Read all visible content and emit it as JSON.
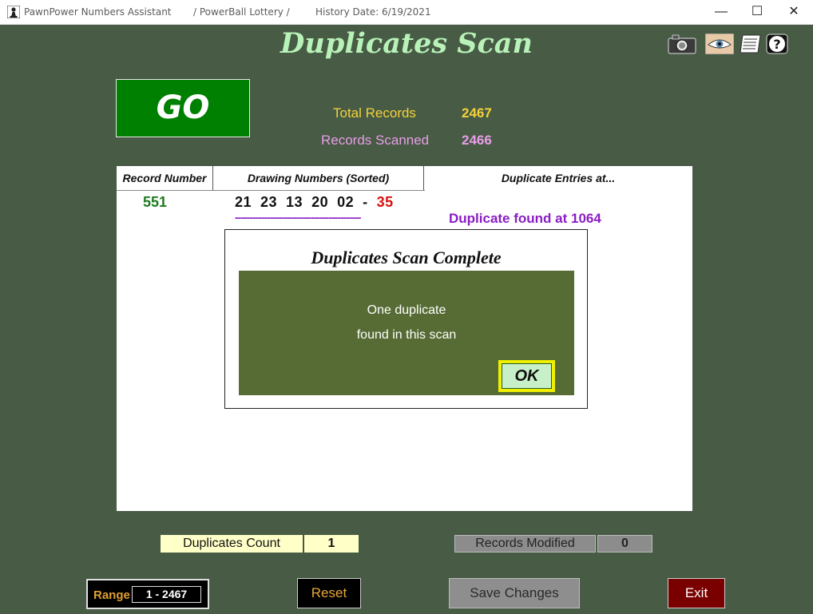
{
  "window": {
    "app_name": "PawnPower Numbers Assistant",
    "lottery": "/ PowerBall Lottery /",
    "history_date": "History Date:  6/19/2021",
    "minimize": "—",
    "maximize": "☐",
    "close": "✕"
  },
  "header": {
    "title": "Duplicates Scan",
    "icons": [
      "camera-icon",
      "eye-icon",
      "notes-icon",
      "help-icon"
    ]
  },
  "go_button": {
    "label": "GO"
  },
  "stats": {
    "total_label": "Total Records",
    "total_value": "2467",
    "scanned_label": "Records Scanned",
    "scanned_value": "2466"
  },
  "table": {
    "col_record": "Record Number",
    "col_drawing": "Drawing Numbers (Sorted)",
    "col_duplicate": "Duplicate Entries at...",
    "row": {
      "record": "551",
      "numbers": "21  23  13  20  02  -  ",
      "powerball": "35",
      "dashes": "-------------------------------------------",
      "duplicate": "Duplicate found at 1064"
    }
  },
  "dialog": {
    "title": "Duplicates Scan Complete",
    "message_line1": "One duplicate",
    "message_line2": "found in this scan",
    "ok_label": "OK"
  },
  "footer": {
    "dup_count_label": "Duplicates Count",
    "dup_count_value": "1",
    "modified_label": "Records Modified",
    "modified_value": "0",
    "range_label": "Range",
    "range_value": "1 - 2467",
    "reset_label": "Reset",
    "save_label": "Save Changes",
    "exit_label": "Exit"
  },
  "colors": {
    "background": "#475b45",
    "title": "#b8f2b8",
    "go": "#008000",
    "total": "#f4d23c",
    "scanned": "#e89ee8",
    "powerball": "#d81010",
    "duplicate": "#8a1cc4",
    "dialog_box": "#576c34"
  }
}
